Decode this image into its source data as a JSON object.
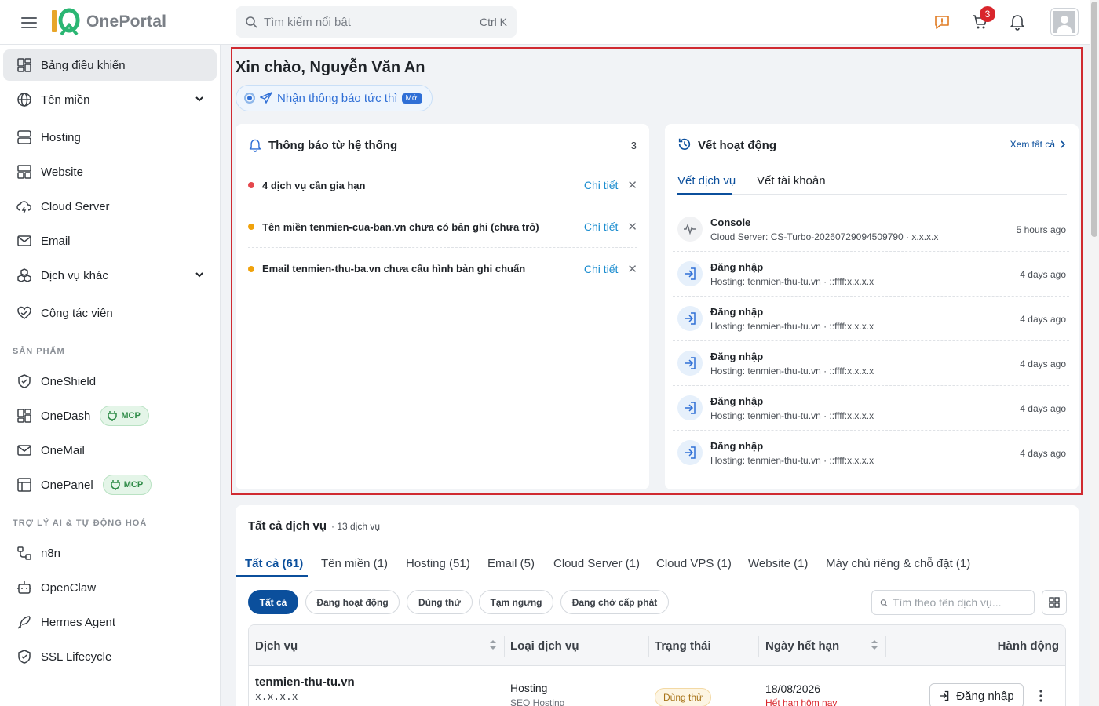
{
  "topbar": {
    "logo_text": "OnePortal",
    "search_placeholder": "Tìm kiếm nổi bật",
    "search_shortcut": "Ctrl K",
    "cart_count": "3",
    "accent_color": "#0b4f9c"
  },
  "sidebar": {
    "items": [
      {
        "label": "Bảng điều khiển",
        "icon": "dashboard-icon"
      },
      {
        "label": "Tên miền",
        "icon": "globe-icon"
      },
      {
        "label": "Hosting",
        "icon": "server-icon"
      },
      {
        "label": "Website",
        "icon": "website-icon"
      },
      {
        "label": "Cloud Server",
        "icon": "cloud-icon"
      },
      {
        "label": "Email",
        "icon": "mail-icon"
      },
      {
        "label": "Dịch vụ khác",
        "icon": "boxes-icon"
      },
      {
        "label": "Cộng tác viên",
        "icon": "handshake-icon"
      }
    ],
    "section_products": "SẢN PHẨM",
    "products": [
      {
        "label": "OneShield",
        "icon": "shield-icon"
      },
      {
        "label": "OneDash",
        "icon": "dashboard-icon",
        "badge": "MCP"
      },
      {
        "label": "OneMail",
        "icon": "mail-icon"
      },
      {
        "label": "OnePanel",
        "icon": "panel-icon",
        "badge": "MCP"
      }
    ],
    "section_ai": "TRỢ LÝ AI & TỰ ĐỘNG HOÁ",
    "ai": [
      {
        "label": "n8n",
        "icon": "workflow-icon"
      },
      {
        "label": "OpenClaw",
        "icon": "robot-icon"
      },
      {
        "label": "Hermes Agent",
        "icon": "feather-icon"
      },
      {
        "label": "SSL Lifecycle",
        "icon": "shield-check-icon"
      }
    ]
  },
  "main": {
    "greeting": "Xin chào, Nguyễn Văn An",
    "notify_pill": "Nhận thông báo tức thì",
    "notify_new": "Mới"
  },
  "system_notices": {
    "title": "Thông báo từ hệ thống",
    "count": "3",
    "detail_label": "Chi tiết",
    "items": [
      {
        "text": "4 dịch vụ cần gia hạn",
        "color": "#e5484d"
      },
      {
        "text": "Tên miền tenmien-cua-ban.vn chưa có bản ghi (chưa trỏ)",
        "color": "#f0a20b"
      },
      {
        "text": "Email tenmien-thu-ba.vn chưa cấu hình bản ghi chuẩn",
        "color": "#f0a20b"
      }
    ]
  },
  "activity": {
    "title": "Vết hoạt động",
    "view_all": "Xem tất cả",
    "tabs": [
      "Vết dịch vụ",
      "Vết tài khoản"
    ],
    "items": [
      {
        "title": "Console",
        "sub": "Cloud Server: CS-Turbo-20260729094509790 · x.x.x.x",
        "time": "5 hours ago",
        "icon": "activity-icon"
      },
      {
        "title": "Đăng nhập",
        "sub": "Hosting: tenmien-thu-tu.vn · ::ffff:x.x.x.x",
        "time": "4 days ago",
        "icon": "login-icon"
      },
      {
        "title": "Đăng nhập",
        "sub": "Hosting: tenmien-thu-tu.vn · ::ffff:x.x.x.x",
        "time": "4 days ago",
        "icon": "login-icon"
      },
      {
        "title": "Đăng nhập",
        "sub": "Hosting: tenmien-thu-tu.vn · ::ffff:x.x.x.x",
        "time": "4 days ago",
        "icon": "login-icon"
      },
      {
        "title": "Đăng nhập",
        "sub": "Hosting: tenmien-thu-tu.vn · ::ffff:x.x.x.x",
        "time": "4 days ago",
        "icon": "login-icon"
      },
      {
        "title": "Đăng nhập",
        "sub": "Hosting: tenmien-thu-tu.vn · ::ffff:x.x.x.x",
        "time": "4 days ago",
        "icon": "login-icon"
      }
    ]
  },
  "services": {
    "title": "Tất cả dịch vụ",
    "count_label": "· 13 dịch vụ",
    "tabs": [
      "Tất cả (61)",
      "Tên miền (1)",
      "Hosting (51)",
      "Email (5)",
      "Cloud Server (1)",
      "Cloud VPS (1)",
      "Website (1)",
      "Máy chủ riêng & chỗ đặt (1)"
    ],
    "filters": [
      "Tất cả",
      "Đang hoạt động",
      "Dùng thử",
      "Tạm ngưng",
      "Đang chờ cấp phát"
    ],
    "search_placeholder": "Tìm theo tên dịch vụ...",
    "columns": [
      "Dịch vụ",
      "Loại dịch vụ",
      "Trạng thái",
      "Ngày hết hạn",
      "Hành động"
    ],
    "row": {
      "name": "tenmien-thu-tu.vn",
      "ip": "x.x.x.x",
      "type": "Hosting",
      "subtype": "SEO Hosting",
      "status": "Dùng thử",
      "expiry": "18/08/2026",
      "expiry_note": "Hết hạn hôm nay",
      "action": "Đăng nhập"
    }
  }
}
